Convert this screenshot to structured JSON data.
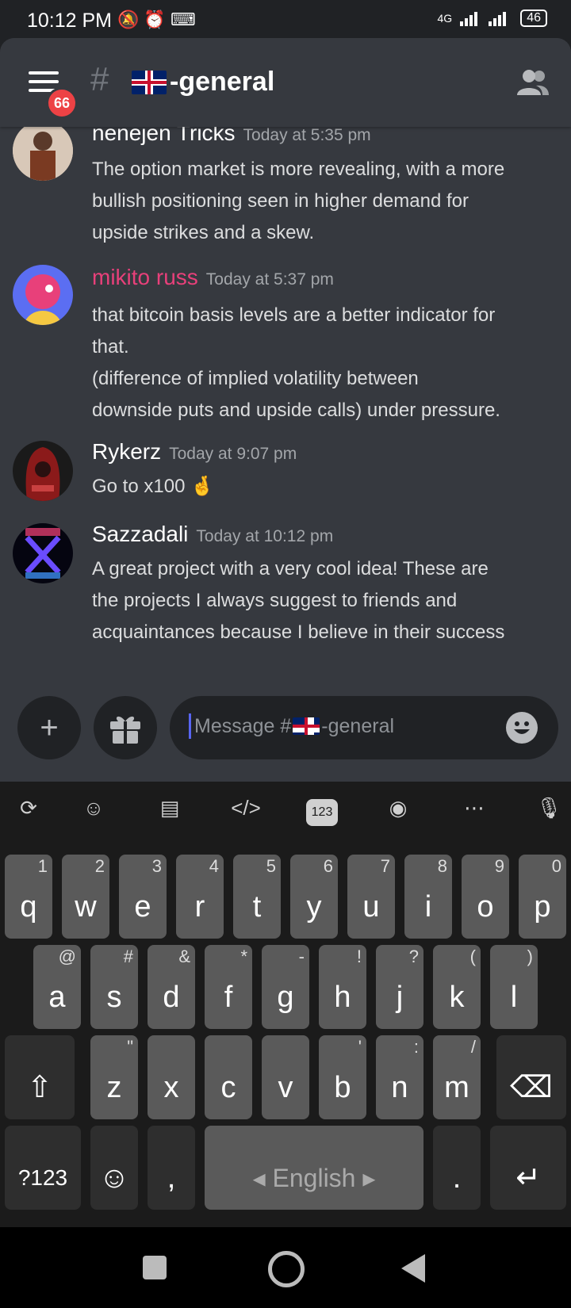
{
  "status_bar": {
    "time": "10:12 PM",
    "network": "4G",
    "battery": "46"
  },
  "header": {
    "menu_badge": "66",
    "channel_name": "-general"
  },
  "messages": [
    {
      "author": "nenejen Tricks",
      "timestamp": "Today at 5:35 pm",
      "author_color": "#ffffff",
      "lines": [
        "The option market is more revealing, with a more",
        "bullish positioning seen in higher demand for",
        "upside strikes and a skew."
      ]
    },
    {
      "author": "mikito russ",
      "timestamp": "Today at 5:37 pm",
      "author_color": "#e8407a",
      "lines": [
        "that bitcoin basis levels are a better indicator for",
        "that.",
        "(difference of implied volatility between",
        "downside puts and upside calls) under pressure."
      ]
    },
    {
      "author": "Rykerz",
      "timestamp": "Today at 9:07 pm",
      "author_color": "#ffffff",
      "lines": [
        "Go to x100 🤞"
      ]
    },
    {
      "author": "Sazzadali",
      "timestamp": "Today at 10:12 pm",
      "author_color": "#ffffff",
      "lines": [
        "A great project with a very cool idea! These are",
        "the projects I always suggest to friends and",
        "acquaintances because I believe in their success"
      ]
    }
  ],
  "composer": {
    "placeholder_prefix": "Message #",
    "placeholder_suffix": "-general"
  },
  "keyboard": {
    "row1": [
      {
        "k": "q",
        "h": "1"
      },
      {
        "k": "w",
        "h": "2"
      },
      {
        "k": "e",
        "h": "3"
      },
      {
        "k": "r",
        "h": "4"
      },
      {
        "k": "t",
        "h": "5"
      },
      {
        "k": "y",
        "h": "6"
      },
      {
        "k": "u",
        "h": "7"
      },
      {
        "k": "i",
        "h": "8"
      },
      {
        "k": "o",
        "h": "9"
      },
      {
        "k": "p",
        "h": "0"
      }
    ],
    "row2": [
      {
        "k": "a",
        "h": "@"
      },
      {
        "k": "s",
        "h": "#"
      },
      {
        "k": "d",
        "h": "&"
      },
      {
        "k": "f",
        "h": "*"
      },
      {
        "k": "g",
        "h": "-"
      },
      {
        "k": "h",
        "h": "!"
      },
      {
        "k": "j",
        "h": "?"
      },
      {
        "k": "k",
        "h": "("
      },
      {
        "k": "l",
        "h": ")"
      }
    ],
    "row3": [
      {
        "k": "z",
        "h": "\""
      },
      {
        "k": "x",
        "h": ""
      },
      {
        "k": "c",
        "h": ""
      },
      {
        "k": "v",
        "h": ""
      },
      {
        "k": "b",
        "h": "'"
      },
      {
        "k": "n",
        "h": ":"
      },
      {
        "k": "m",
        "h": "/"
      }
    ],
    "symbols_label": "?123",
    "comma_label": ",",
    "space_label": "English",
    "period_label": ".",
    "toolbar_123": "123"
  }
}
